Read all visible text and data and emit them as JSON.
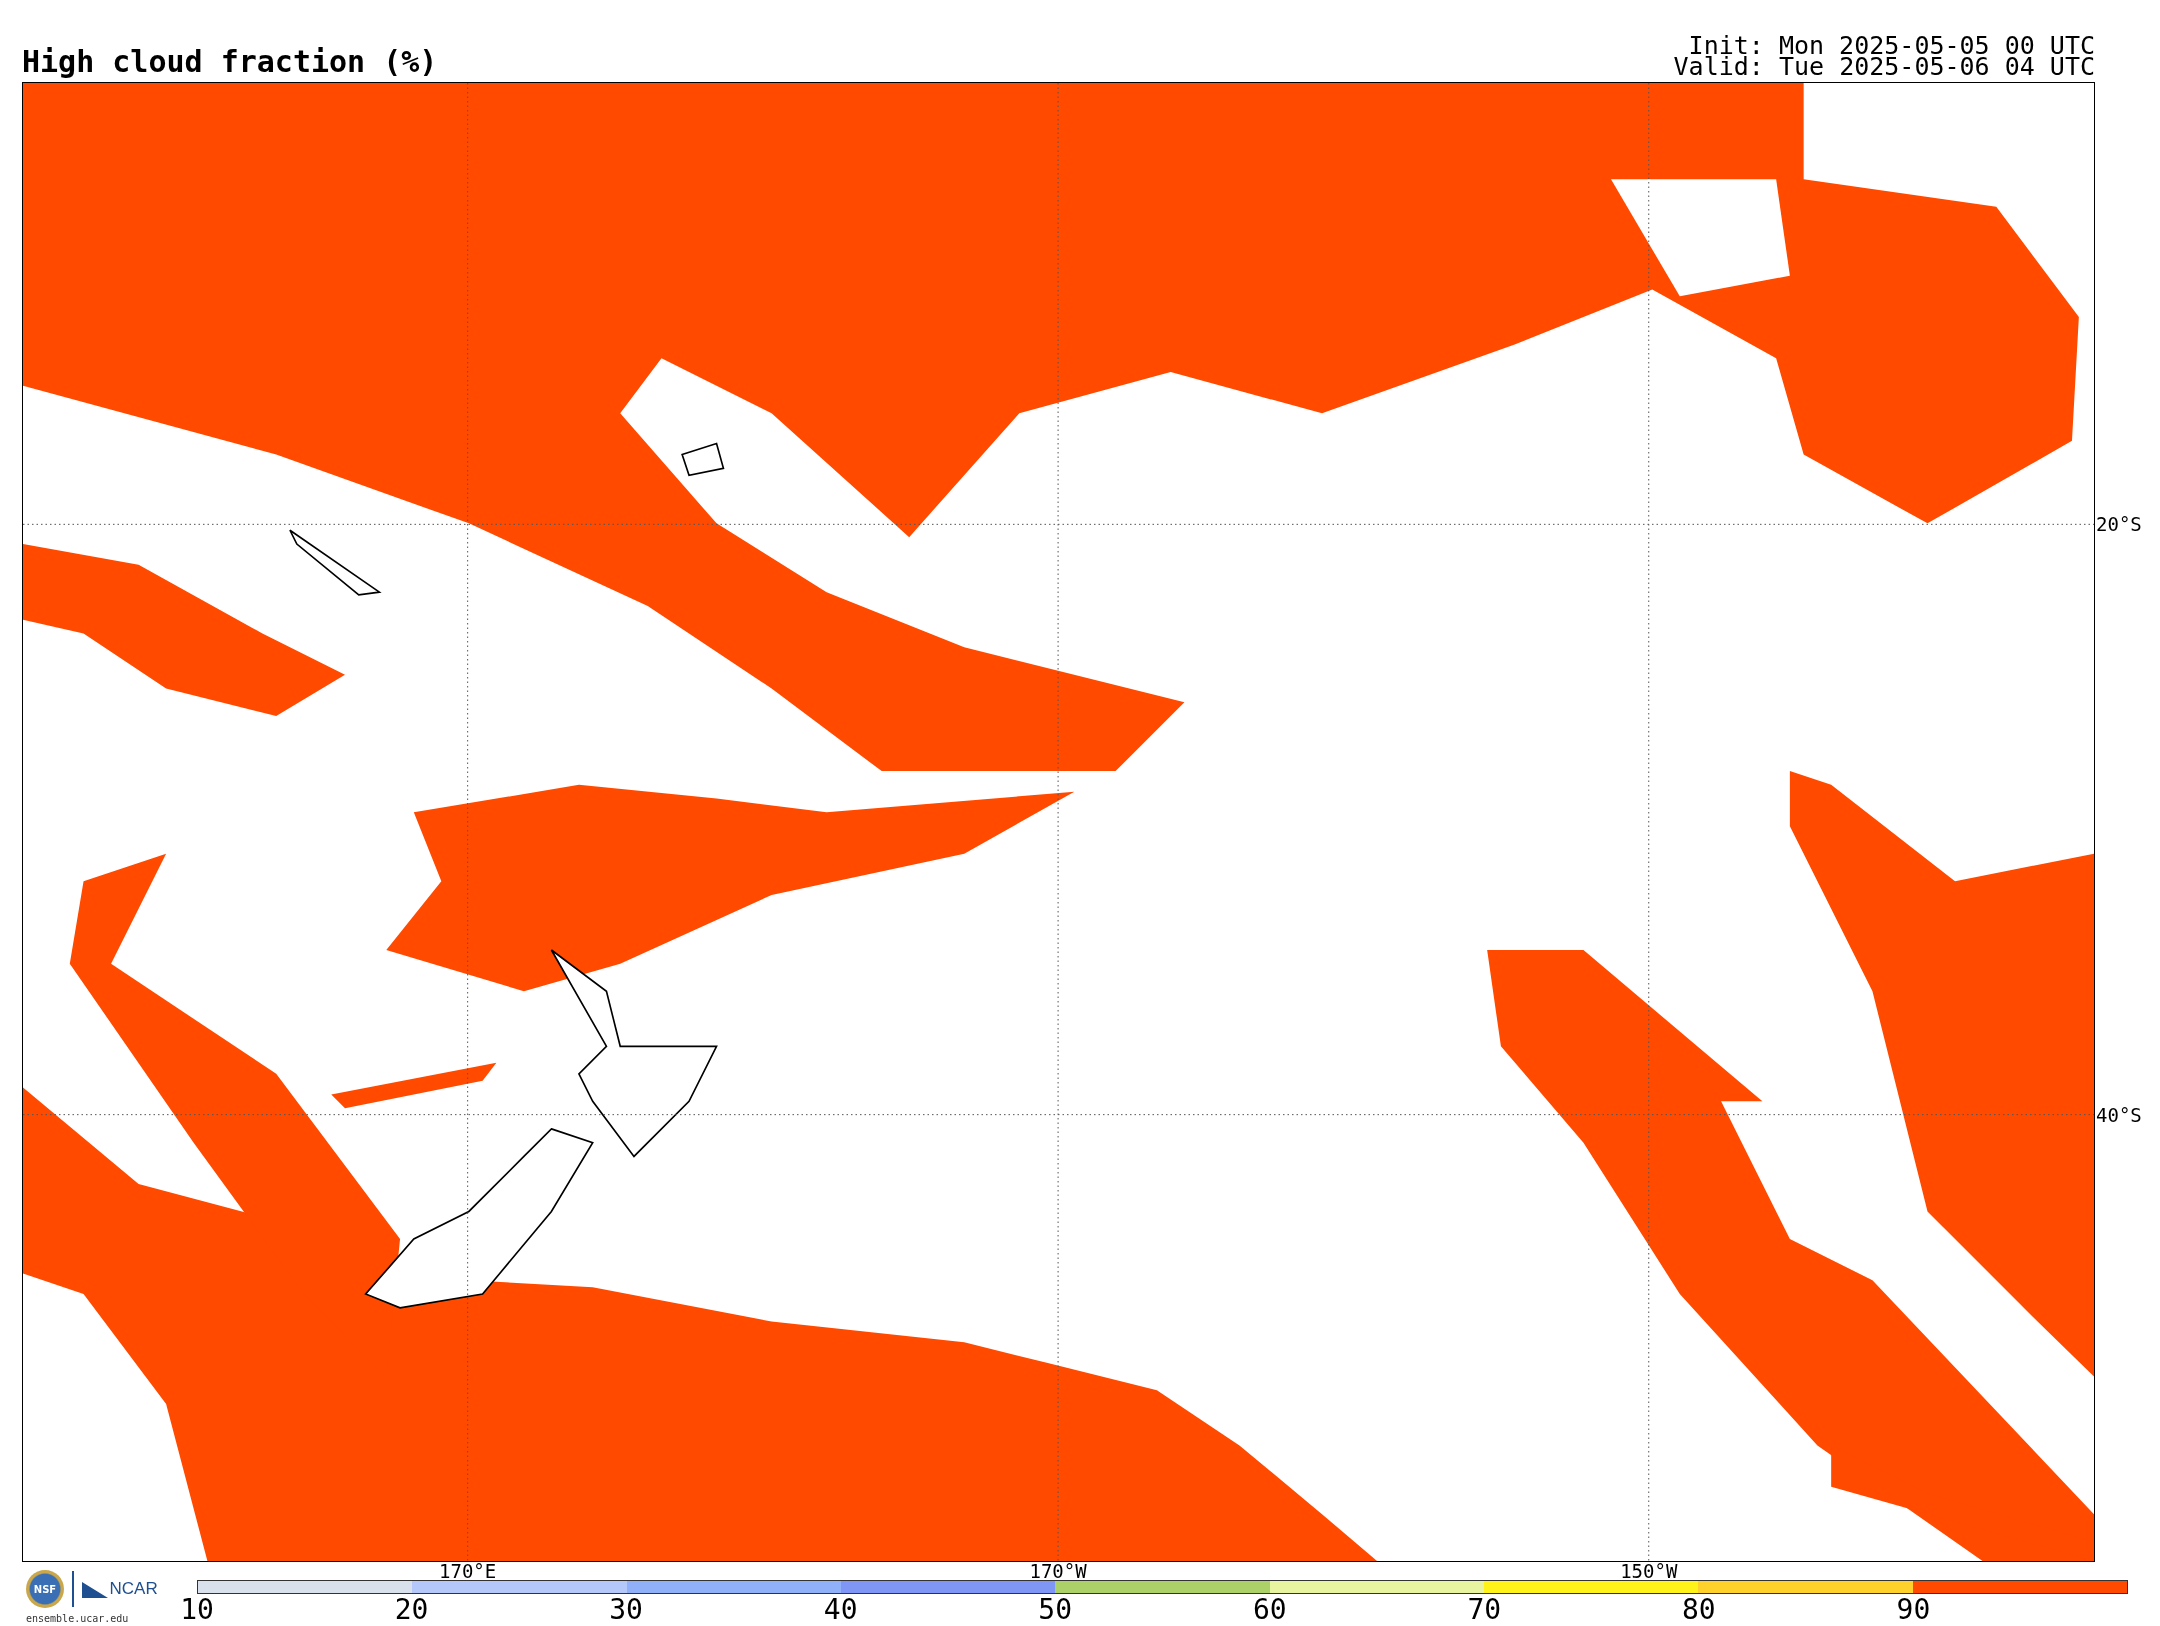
{
  "title": "High cloud fraction (%)",
  "init": "Init: Mon 2025-05-05 00 UTC",
  "valid": "Valid: Tue 2025-05-06 04 UTC",
  "map": {
    "lon_labels": [
      "170°E",
      "170°W",
      "150°W"
    ],
    "lat_labels": [
      "20°S",
      "40°S"
    ]
  },
  "logo": {
    "nsf": "NSF",
    "ncar": "NCAR",
    "url": "ensemble.ucar.edu"
  },
  "colorbar": {
    "segments": [
      {
        "color": "#d9e2ec"
      },
      {
        "color": "#b4c8fa"
      },
      {
        "color": "#90b0fa"
      },
      {
        "color": "#8096f6"
      },
      {
        "color": "#acd168"
      },
      {
        "color": "#e8f4a0"
      },
      {
        "color": "#fff31a"
      },
      {
        "color": "#ffd12a"
      },
      {
        "color": "#ff4a00"
      }
    ],
    "ticks": [
      "10",
      "20",
      "30",
      "40",
      "50",
      "60",
      "70",
      "80",
      "90"
    ]
  }
}
